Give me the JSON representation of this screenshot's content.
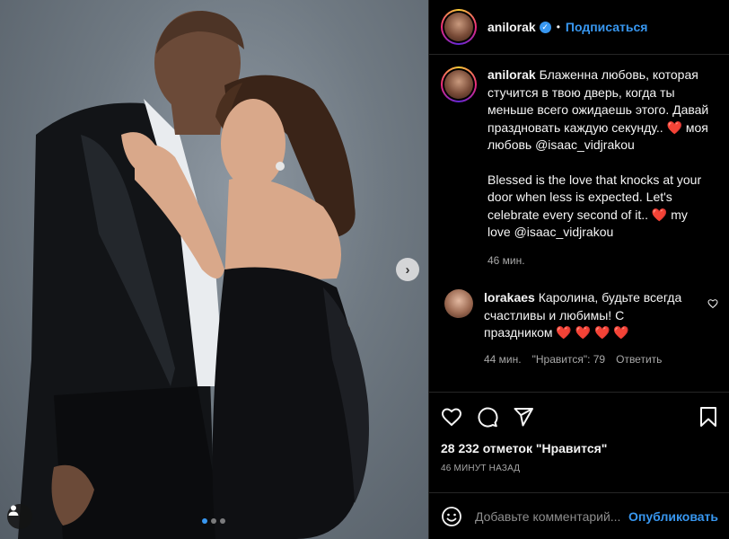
{
  "post": {
    "username": "anilorak",
    "follow_label": "Подписаться",
    "separator": "•",
    "caption_ru": "Блаженна любовь, которая стучится в твою дверь, когда ты меньше всего ожидаешь этого. Давай праздновать каждую секунду..",
    "caption_ru_tail": "моя любовь @isaac_vidjrakou",
    "caption_en": "Blessed is the love that knocks at your door when less is expected. Let's celebrate every second of it..",
    "caption_en_tail": "my love @isaac_vidjrakou",
    "caption_time": "46 мин.",
    "likes_count": "28 232 отметок \"Нравится\"",
    "posted_ago": "46 МИНУТ НАЗАД",
    "heart_glyph": "❤️"
  },
  "comment": {
    "username": "lorakaes",
    "text": "Каролина, будьте всегда счастливы и любимы! С праздником",
    "hearts": "❤️ ❤️ ❤️ ❤️",
    "time": "44 мин.",
    "likes": "\"Нравится\": 79",
    "reply": "Ответить"
  },
  "composer": {
    "placeholder": "Добавьте комментарий...",
    "publish": "Опубликовать"
  },
  "carousel": {
    "slide_count": 3,
    "active_index": 0
  },
  "icons": {
    "next": "chevron-right-icon",
    "tags": "user-tag-icon",
    "like": "heart-icon",
    "comment": "comment-icon",
    "share": "send-icon",
    "save": "bookmark-icon",
    "emoji": "emoji-icon",
    "verified": "verified-badge-icon"
  },
  "colors": {
    "accent": "#3897f0",
    "heart": "#ed2e45",
    "background": "#000000",
    "muted": "#a8a8a8"
  }
}
